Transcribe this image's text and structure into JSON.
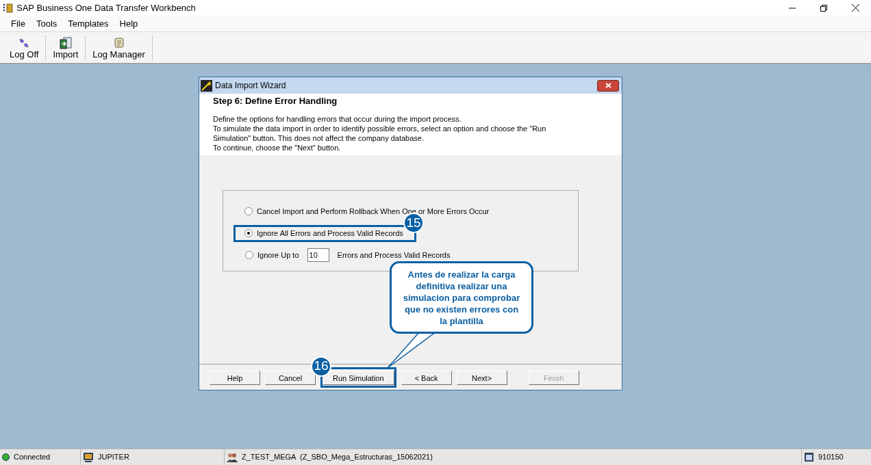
{
  "window": {
    "title": "SAP Business One Data Transfer Workbench"
  },
  "menu": [
    {
      "label": "File"
    },
    {
      "label": "Tools"
    },
    {
      "label": "Templates"
    },
    {
      "label": "Help"
    }
  ],
  "toolbar": [
    {
      "label": "Log Off"
    },
    {
      "label": "Import"
    },
    {
      "label": "Log Manager"
    }
  ],
  "dialog": {
    "title": "Data Import Wizard",
    "step_title": "Step 6: Define Error Handling",
    "description": [
      "Define the options for handling errors that occur during the import process.",
      "To simulate the data import in order to identify possible errors, select an option and choose the \"Run Simulation\" button. This does not affect the company database.",
      "To continue, choose the \"Next\" button."
    ],
    "options": [
      {
        "kind": "plain",
        "label": "Cancel Import and Perform Rollback When One or More Errors Occur",
        "selected": false
      },
      {
        "kind": "plain",
        "label": "Ignore All Errors and Process Valid Records",
        "selected": true,
        "badge": "15"
      },
      {
        "kind": "count",
        "label": "Ignore Up to",
        "value": "10",
        "suffix": "Errors and Process Valid Records",
        "selected": false
      }
    ],
    "buttons": [
      {
        "label": "Help",
        "disabled": false
      },
      {
        "label": "Cancel",
        "disabled": false
      },
      {
        "label": "Run Simulation",
        "disabled": false,
        "badge": "16"
      },
      {
        "label": "< Back",
        "disabled": false
      },
      {
        "label": "Next>",
        "disabled": false
      },
      {
        "label": "Finish",
        "disabled": true
      }
    ],
    "callout": "Antes de realizar la carga definitiva realizar una simulacion para comprobar que no existen errores con la plantilla"
  },
  "status_bar": {
    "connection": {
      "label": "Connected",
      "on": true
    },
    "server": "JUPITER",
    "company": "Z_TEST_MEGA  (Z_SBO_Mega_Estructuras_15062021)",
    "user_code": "910150"
  }
}
